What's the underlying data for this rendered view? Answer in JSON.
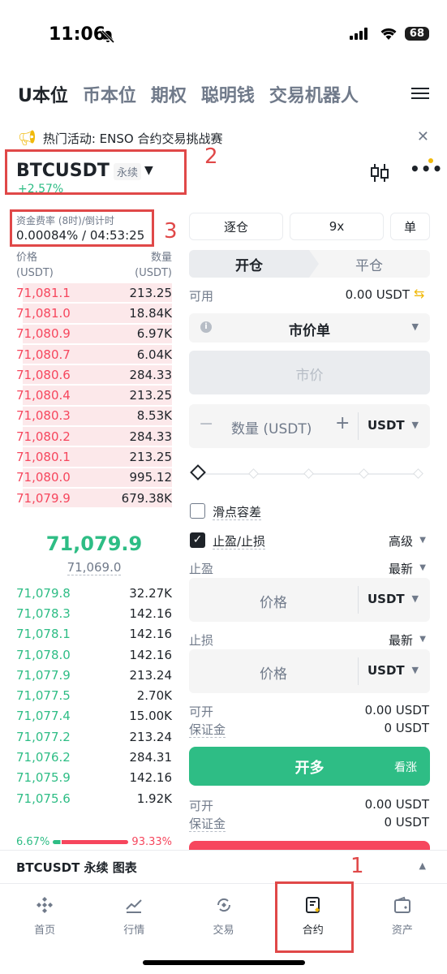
{
  "status": {
    "time": "11:06",
    "battery": "68"
  },
  "nav": {
    "tabs": [
      "U本位",
      "币本位",
      "期权",
      "聪明钱",
      "交易机器人"
    ]
  },
  "banner": {
    "text": "热门活动: ENSO 合约交易挑战赛"
  },
  "header": {
    "symbol": "BTCUSDT",
    "contract_type": "永续",
    "change": "+2.57%"
  },
  "annotations": {
    "a1": "1",
    "a2": "2",
    "a3": "3"
  },
  "funding": {
    "label": "资金费率 (8时)/倒计时",
    "value": "0.00084% / 04:53:25"
  },
  "orderbook": {
    "price_label": "价格",
    "price_unit": "(USDT)",
    "qty_label": "数量",
    "qty_unit": "(USDT)",
    "asks": [
      {
        "price": "71,081.1",
        "qty": "213.25"
      },
      {
        "price": "71,081.0",
        "qty": "18.84K"
      },
      {
        "price": "71,080.9",
        "qty": "6.97K"
      },
      {
        "price": "71,080.7",
        "qty": "6.04K"
      },
      {
        "price": "71,080.6",
        "qty": "284.33"
      },
      {
        "price": "71,080.4",
        "qty": "213.25"
      },
      {
        "price": "71,080.3",
        "qty": "8.53K"
      },
      {
        "price": "71,080.2",
        "qty": "284.33"
      },
      {
        "price": "71,080.1",
        "qty": "213.25"
      },
      {
        "price": "71,080.0",
        "qty": "995.12"
      },
      {
        "price": "71,079.9",
        "qty": "679.38K"
      }
    ],
    "last_price": "71,079.9",
    "mark_price": "71,069.0",
    "bids": [
      {
        "price": "71,079.8",
        "qty": "32.27K"
      },
      {
        "price": "71,078.3",
        "qty": "142.16"
      },
      {
        "price": "71,078.1",
        "qty": "142.16"
      },
      {
        "price": "71,078.0",
        "qty": "142.16"
      },
      {
        "price": "71,077.9",
        "qty": "213.24"
      },
      {
        "price": "71,077.5",
        "qty": "2.70K"
      },
      {
        "price": "71,077.4",
        "qty": "15.00K"
      },
      {
        "price": "71,077.2",
        "qty": "213.24"
      },
      {
        "price": "71,076.2",
        "qty": "284.31"
      },
      {
        "price": "71,075.9",
        "qty": "142.16"
      },
      {
        "price": "71,075.6",
        "qty": "1.92K"
      }
    ],
    "buy_ratio": "6.67%",
    "sell_ratio": "93.33%"
  },
  "trade": {
    "margin_mode": "逐仓",
    "leverage": "9x",
    "position_mode": "单",
    "open_tab": "开仓",
    "close_tab": "平仓",
    "available_label": "可用",
    "available_value": "0.00 USDT",
    "order_type": "市价单",
    "price_placeholder": "市价",
    "qty_placeholder": "数量 (USDT)",
    "qty_unit": "USDT",
    "slippage_label": "滑点容差",
    "tpsl_label": "止盈/止损",
    "advanced_label": "高级",
    "tp_label": "止盈",
    "tp_trigger": "最新",
    "tp_placeholder": "价格",
    "tp_unit": "USDT",
    "sl_label": "止损",
    "sl_trigger": "最新",
    "sl_placeholder": "价格",
    "sl_unit": "USDT",
    "long": {
      "openable_label": "可开",
      "openable_value": "0.00 USDT",
      "margin_label": "保证金",
      "margin_value": "0 USDT",
      "button": "开多",
      "button_sub": "看涨"
    },
    "short": {
      "openable_label": "可开",
      "openable_value": "0.00 USDT",
      "margin_label": "保证金",
      "margin_value": "0 USDT"
    }
  },
  "chart_bar": {
    "label": "BTCUSDT 永续 图表"
  },
  "tabbar": {
    "items": [
      "首页",
      "行情",
      "交易",
      "合约",
      "资产"
    ]
  }
}
